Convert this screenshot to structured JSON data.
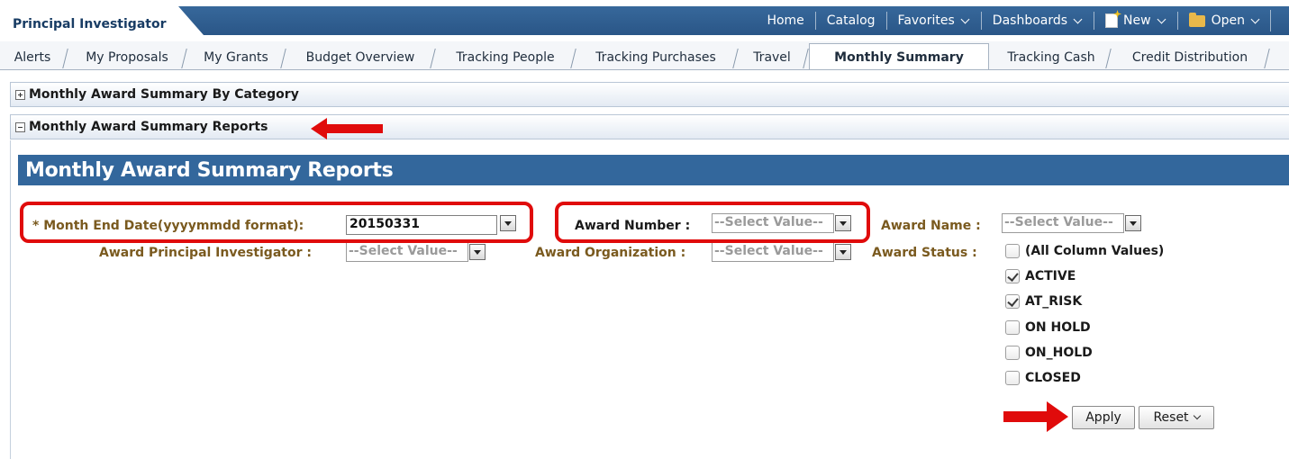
{
  "header": {
    "dashboard_title": "Principal Investigator",
    "nav": [
      {
        "label": "Home"
      },
      {
        "label": "Catalog"
      },
      {
        "label": "Favorites"
      },
      {
        "label": "Dashboards"
      },
      {
        "label": "New"
      },
      {
        "label": "Open"
      }
    ]
  },
  "tabs": [
    {
      "label": "Alerts"
    },
    {
      "label": "My Proposals"
    },
    {
      "label": "My Grants"
    },
    {
      "label": "Budget Overview"
    },
    {
      "label": "Tracking People"
    },
    {
      "label": "Tracking Purchases"
    },
    {
      "label": "Travel"
    },
    {
      "label": "Monthly Summary",
      "active": true
    },
    {
      "label": "Tracking Cash"
    },
    {
      "label": "Credit Distribution"
    }
  ],
  "sections": {
    "by_category": "Monthly Award Summary By Category",
    "reports": "Monthly Award Summary Reports"
  },
  "report": {
    "title": "Monthly Award Summary Reports"
  },
  "prompts": {
    "month_end_required": "* ",
    "month_end_label": "Month End Date(yyyymmdd format):",
    "month_end_value": "20150331",
    "award_number_label": "Award Number :",
    "award_number_value": "--Select Value--",
    "award_name_label": "Award Name :",
    "award_name_value": "--Select Value--",
    "award_pi_label": "Award Principal Investigator :",
    "award_pi_value": "--Select Value--",
    "award_org_label": "Award Organization :",
    "award_org_value": "--Select Value--",
    "award_status_label": "Award Status :"
  },
  "award_status_options": [
    {
      "label": "(All Column Values)",
      "checked": false
    },
    {
      "label": "ACTIVE",
      "checked": true
    },
    {
      "label": "AT_RISK",
      "checked": true
    },
    {
      "label": "ON HOLD",
      "checked": false
    },
    {
      "label": "ON_HOLD",
      "checked": false
    },
    {
      "label": "CLOSED",
      "checked": false
    }
  ],
  "buttons": {
    "apply": "Apply",
    "reset": "Reset"
  },
  "colors": {
    "header_blue": "#2a5687",
    "report_header_blue": "#33679c",
    "annotation_red": "#e00b0b",
    "prompt_label": "#7a5a1f"
  }
}
